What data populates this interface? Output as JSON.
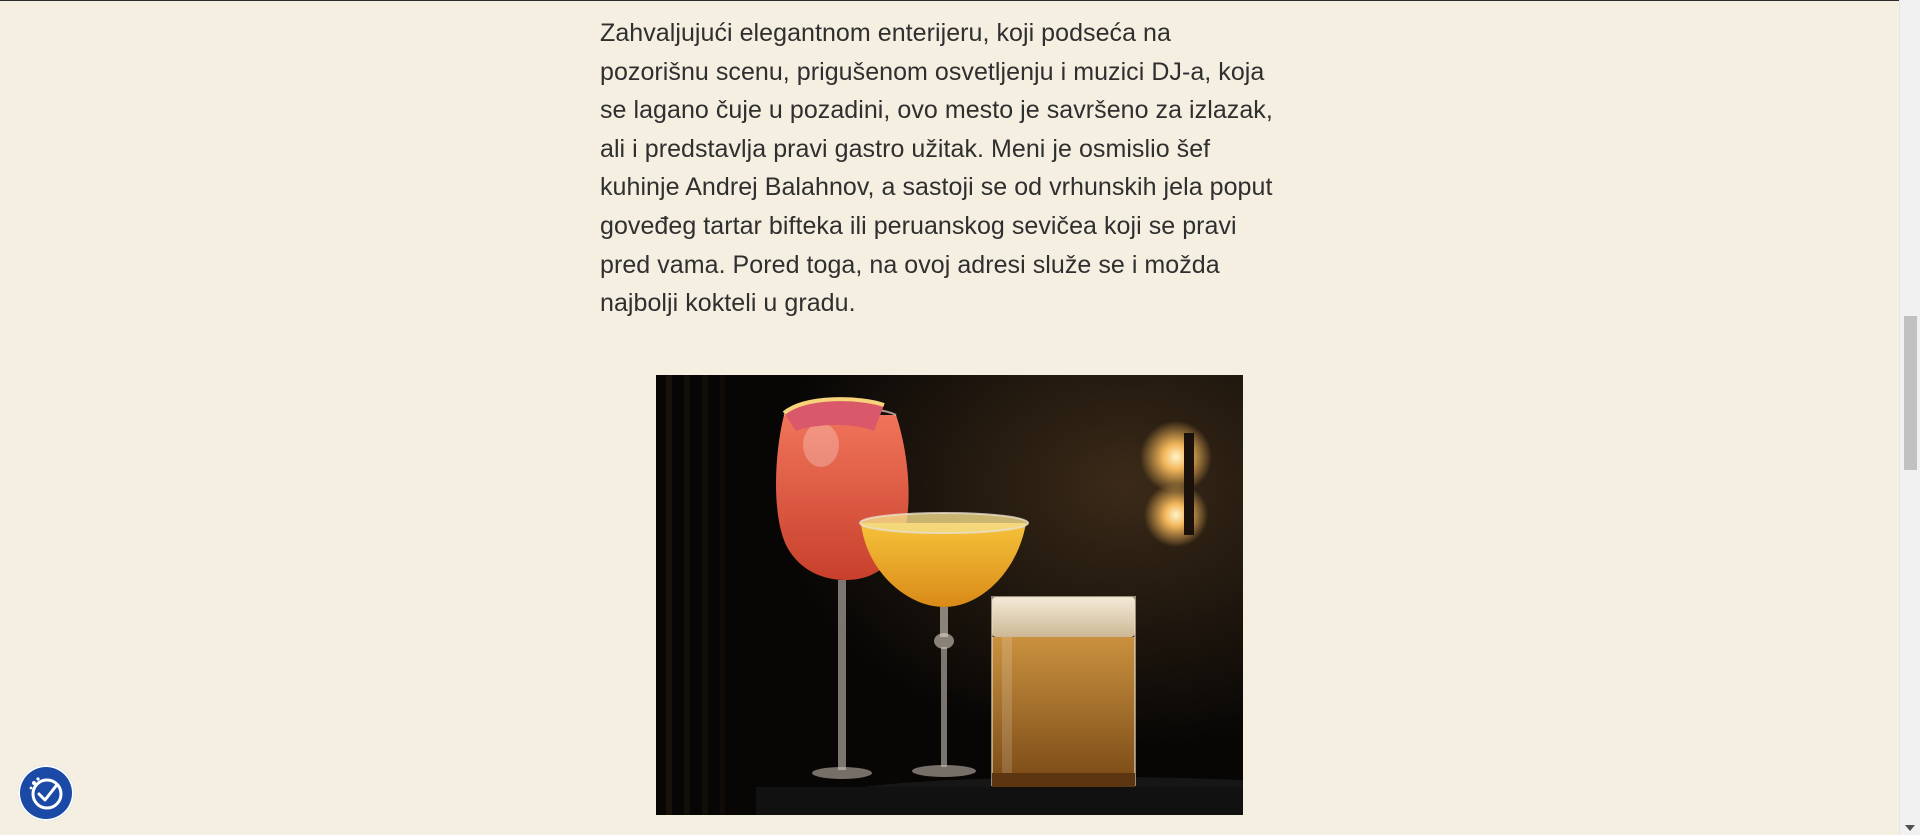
{
  "article": {
    "paragraph_lines": [
      "Zahvaljujući elegantnom enterijeru, koji podseća na",
      "pozorišnu scenu, prigušenom osvetljenju i muzici DJ-a, koja",
      "se lagano čuje u pozadini, ovo mesto je savršeno za izlazak,",
      "ali i predstavlja pravi gastro užitak. Meni je osmislio šef",
      "kuhinje Andrej Balahnov, a sastoji se od vrhunskih jela poput",
      "goveđeg tartar bifteka ili peruanskog sevičea koji se pravi",
      "pred vama. Pored toga, na ovoj adresi služe se i možda",
      "najbolji kokteli u gradu."
    ]
  },
  "image": {
    "subject": "three cocktails on a dark bar"
  },
  "widgets": {
    "accessibility_icon": "accessibility-check-icon"
  },
  "colors": {
    "page_background": "#f4efe1",
    "body_text": "#2f2f2f",
    "accessibility_button": "#1a4aa6"
  }
}
